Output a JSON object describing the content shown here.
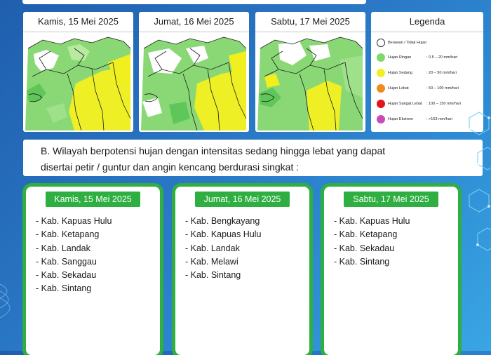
{
  "maps": [
    {
      "date": "Kamis, 15 Mei 2025"
    },
    {
      "date": "Jumat, 16 Mei 2025"
    },
    {
      "date": "Sabtu, 17 Mei 2025"
    }
  ],
  "legend": {
    "title": "Legenda",
    "items": [
      {
        "name": "Berawan / Tidak Hujan",
        "range": "",
        "color": "#ffffff"
      },
      {
        "name": "Hujan Ringan",
        "range": ": 0.5 – 20 mm/hari",
        "color": "#7fd96a"
      },
      {
        "name": "Hujan Sedang",
        "range": ": 20 – 50 mm/hari",
        "color": "#f2ef1f"
      },
      {
        "name": "Hujan Lebat",
        "range": ": 50 – 100 mm/hari",
        "color": "#f08a1c"
      },
      {
        "name": "Hujan Sangat Lebat",
        "range": ": 100 – 150 mm/hari",
        "color": "#e4141b"
      },
      {
        "name": "Hujan Ekstrem",
        "range": ": >153 mm/hari",
        "color": "#c94bb7"
      }
    ]
  },
  "section_b": {
    "line1": "B. Wilayah berpotensi hujan dengan intensitas sedang hingga lebat yang dapat",
    "line2": "disertai petir / guntur dan angin kencang berdurasi singkat :"
  },
  "regions": [
    {
      "date": "Kamis, 15 Mei 2025",
      "items": [
        "- Kab. Kapuas Hulu",
        "- Kab. Ketapang",
        "- Kab. Landak",
        "- Kab. Sanggau",
        "- Kab. Sekadau",
        "- Kab. Sintang"
      ]
    },
    {
      "date": "Jumat, 16 Mei 2025",
      "items": [
        "- Kab. Bengkayang",
        "- Kab. Kapuas Hulu",
        "- Kab. Landak",
        "- Kab. Melawi",
        "- Kab. Sintang"
      ]
    },
    {
      "date": "Sabtu, 17 Mei 2025",
      "items": [
        "- Kab. Kapuas Hulu",
        "- Kab. Ketapang",
        "- Kab. Sekadau",
        "- Kab. Sintang"
      ]
    }
  ]
}
